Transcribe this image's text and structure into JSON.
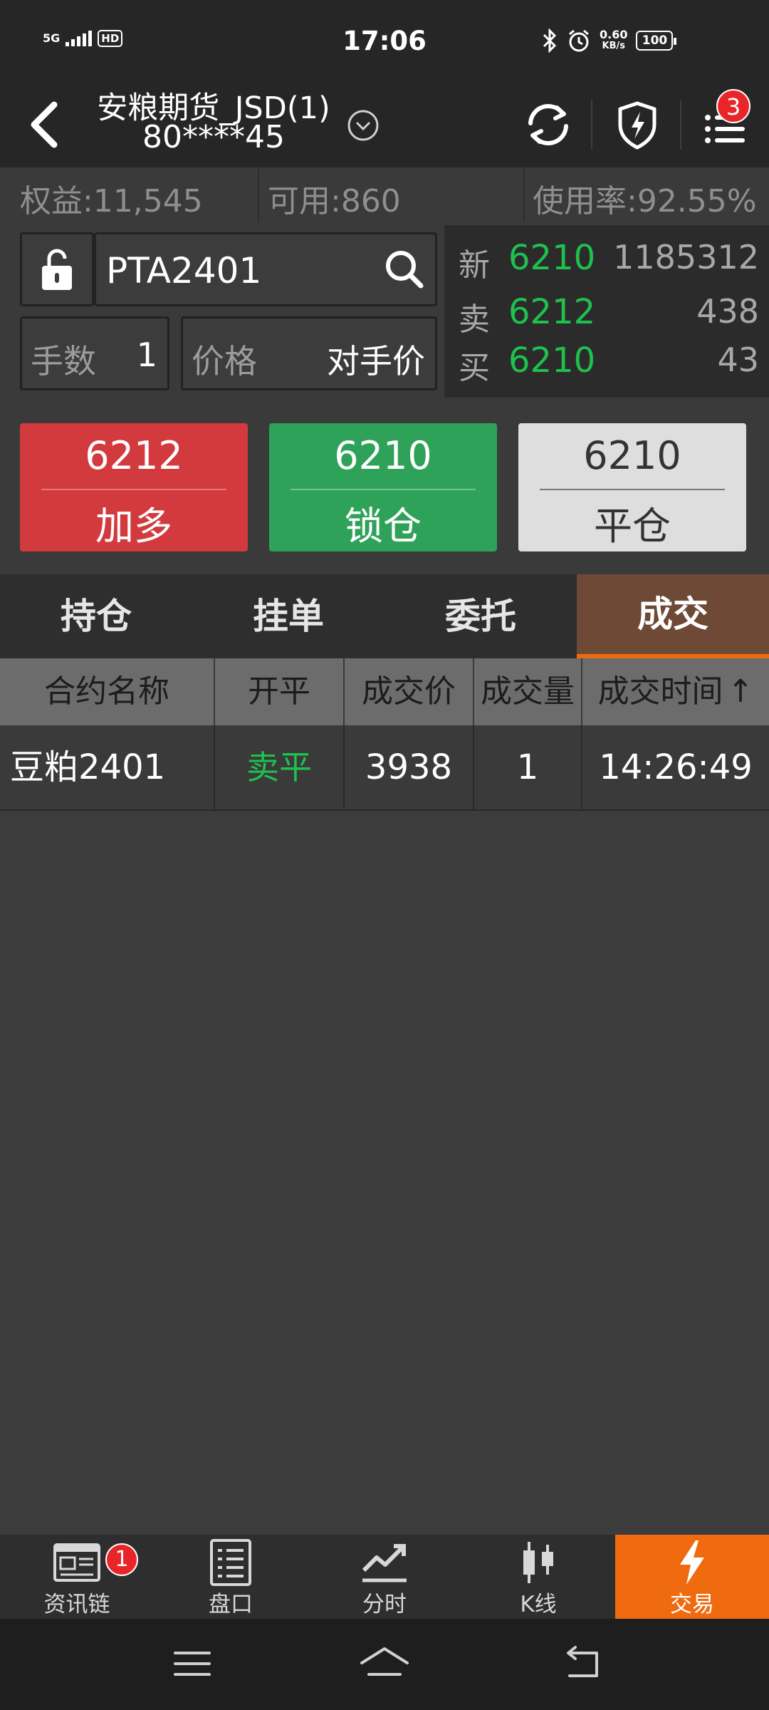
{
  "status_bar": {
    "network": "5G",
    "hd": "HD",
    "time": "17:06",
    "speed_value": "0.60",
    "speed_unit": "KB/s",
    "battery": "100"
  },
  "header": {
    "title": "安粮期货_JSD(1)",
    "account": "80****45",
    "notification_count": "3"
  },
  "account_stats": {
    "equity": "权益:11,545",
    "available": "可用:860",
    "usage": "使用率:92.55%"
  },
  "order_form": {
    "symbol": "PTA2401",
    "qty_label": "手数",
    "qty_value": "1",
    "price_label": "价格",
    "price_value": "对手价"
  },
  "quote": {
    "last_label": "新",
    "last_price": "6210",
    "last_volume": "1185312",
    "ask_label": "卖",
    "ask_price": "6212",
    "ask_volume": "438",
    "bid_label": "买",
    "bid_price": "6210",
    "bid_volume": "43",
    "price_color": "#1fc04e"
  },
  "trade_buttons": {
    "buy_price": "6212",
    "buy_label": "加多",
    "lock_price": "6210",
    "lock_label": "锁仓",
    "close_price": "6210",
    "close_label": "平仓"
  },
  "tabs": [
    "持仓",
    "挂单",
    "委托",
    "成交"
  ],
  "active_tab": "成交",
  "table": {
    "headers": [
      "合约名称",
      "开平",
      "成交价",
      "成交量",
      "成交时间"
    ],
    "sort_indicator": "↑",
    "rows": [
      {
        "contract": "豆粕2401",
        "open_close": "卖平",
        "price": "3938",
        "volume": "1",
        "time": "14:26:49"
      }
    ]
  },
  "bottom_nav": {
    "items": [
      {
        "label": "资讯链",
        "icon": "news-icon",
        "badge": "1"
      },
      {
        "label": "盘口",
        "icon": "orderbook-icon"
      },
      {
        "label": "分时",
        "icon": "timeshare-chart-icon"
      },
      {
        "label": "K线",
        "icon": "candlestick-icon"
      },
      {
        "label": "交易",
        "icon": "lightning-icon"
      }
    ],
    "active": "交易",
    "accent": "#f06a0f"
  }
}
